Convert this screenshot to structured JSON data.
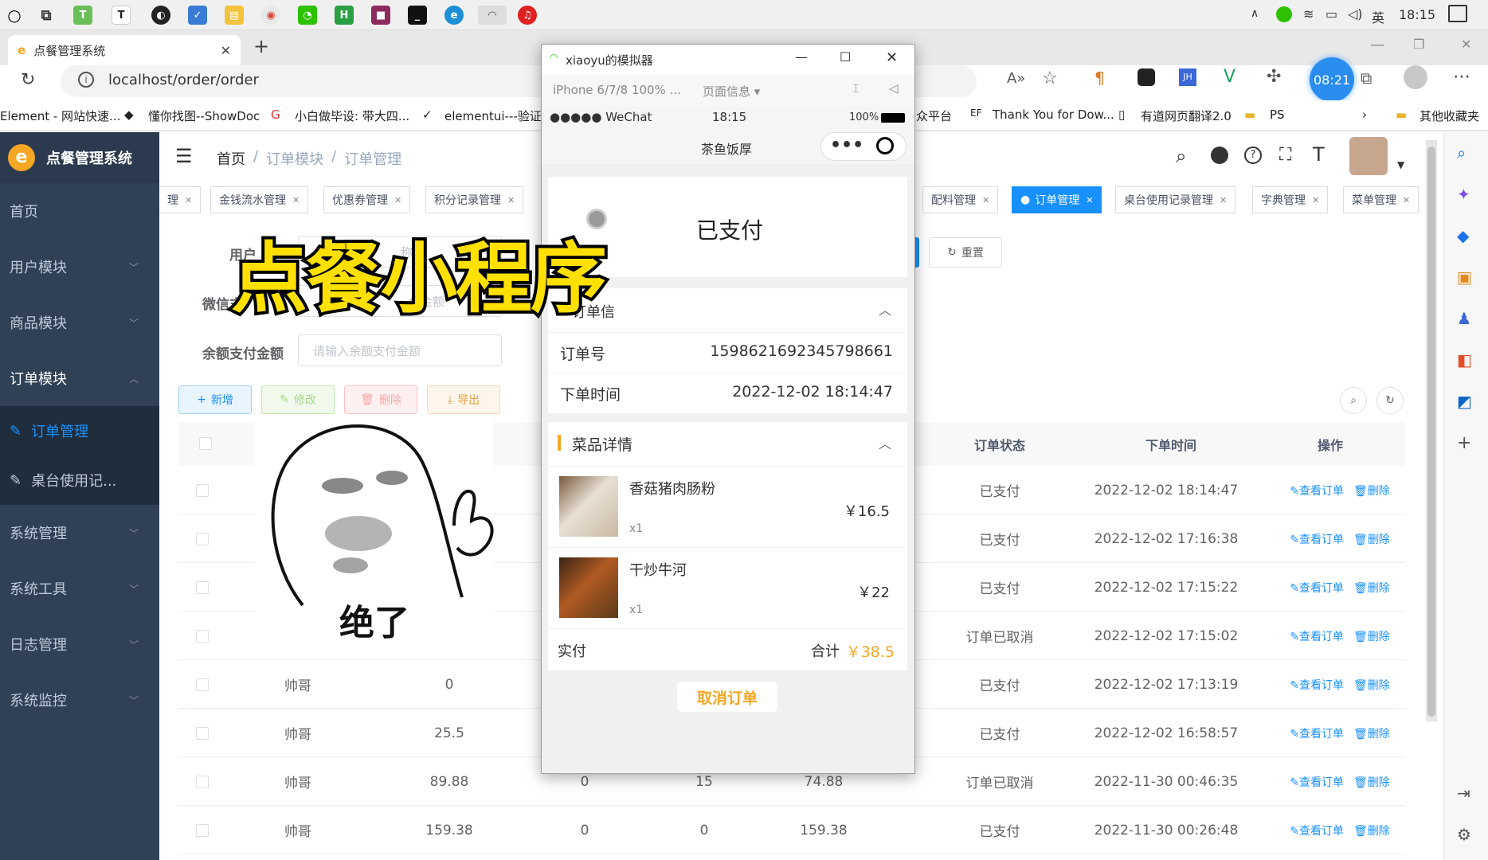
{
  "taskbar": {
    "time": "18:15",
    "ime": "英",
    "app_icons": [
      "cortana-icon",
      "task-view-icon",
      "app-green-icon",
      "typora-icon",
      "app-dark-icon",
      "app-blue-icon",
      "file-explorer-icon",
      "chrome-icon",
      "wechat-icon",
      "hbuilder-icon",
      "jetbrains-icon",
      "terminal-icon",
      "edge-icon",
      "wechat-devtools-icon",
      "netease-music-icon"
    ]
  },
  "browser": {
    "tab_title": "点餐管理系统",
    "url": "localhost/order/order",
    "clock_badge": "08:21",
    "bookmarks": [
      "Element - 网站快速...",
      "懂你找图--ShowDoc",
      "小白做毕设: 带大四...",
      "elementui---验证",
      "众平台",
      "Thank You for Dow...",
      "有道网页翻译2.0",
      "PS",
      "其他收藏夹"
    ]
  },
  "app": {
    "logo_text": "点餐管理系统",
    "menu": [
      {
        "label": "首页",
        "chevron": ""
      },
      {
        "label": "用户模块",
        "chevron": "﹀"
      },
      {
        "label": "商品模块",
        "chevron": "﹀"
      },
      {
        "label": "订单模块",
        "chevron": "︿"
      },
      {
        "label": "订单管理",
        "chevron": ""
      },
      {
        "label": "桌台使用记...",
        "chevron": ""
      },
      {
        "label": "系统管理",
        "chevron": "﹀"
      },
      {
        "label": "系统工具",
        "chevron": "﹀"
      },
      {
        "label": "日志管理",
        "chevron": "﹀"
      },
      {
        "label": "系统监控",
        "chevron": "﹀"
      }
    ],
    "breadcrumb": [
      "首页",
      "订单模块",
      "订单管理"
    ],
    "tags": [
      {
        "label": "理"
      },
      {
        "label": "金钱流水管理"
      },
      {
        "label": "优惠券管理"
      },
      {
        "label": "积分记录管理"
      },
      {
        "label": "配料管理"
      },
      {
        "label": "订单管理",
        "active": true
      },
      {
        "label": "桌台使用记录管理"
      },
      {
        "label": "字典管理"
      },
      {
        "label": "菜单管理"
      }
    ],
    "search": {
      "user_label": "用户",
      "user_placeholder": "称",
      "wechat_label": "微信支",
      "wechat_placeholder": "付金额",
      "balance_label": "余额支付金额",
      "balance_placeholder": "请输入余额支付金额",
      "reset_label": "重置"
    },
    "ops": {
      "add": "新增",
      "edit": "修改",
      "delete": "删除",
      "export": "导出"
    },
    "table": {
      "headers": [
        "订单状态",
        "下单时间",
        "操作"
      ],
      "action_view": "查看订单",
      "action_delete": "删除",
      "rows": [
        {
          "user": "",
          "c1": "",
          "c2": "",
          "c3": "",
          "c4": "",
          "status": "已支付",
          "time": "2022-12-02 18:14:47"
        },
        {
          "user": "",
          "c1": "",
          "c2": "",
          "c3": "",
          "c4": "",
          "status": "已支付",
          "time": "2022-12-02 17:16:38"
        },
        {
          "user": "",
          "c1": "",
          "c2": "",
          "c3": "",
          "c4": "",
          "status": "已支付",
          "time": "2022-12-02 17:15:22"
        },
        {
          "user": "",
          "c1": "",
          "c2": "",
          "c3": "",
          "c4": "",
          "status": "订单已取消",
          "time": "2022-12-02 17:15:02"
        },
        {
          "user": "帅哥",
          "c1": "0",
          "c2": "",
          "c3": "",
          "c4": "",
          "status": "已支付",
          "time": "2022-12-02 17:13:19"
        },
        {
          "user": "帅哥",
          "c1": "25.5",
          "c2": "",
          "c3": "",
          "c4": "",
          "status": "已支付",
          "time": "2022-12-02 16:58:57"
        },
        {
          "user": "帅哥",
          "c1": "89.88",
          "c2": "0",
          "c3": "15",
          "c4": "74.88",
          "status": "订单已取消",
          "time": "2022-11-30 00:46:35"
        },
        {
          "user": "帅哥",
          "c1": "159.38",
          "c2": "0",
          "c3": "0",
          "c4": "159.38",
          "status": "已支付",
          "time": "2022-11-30 00:26:48"
        }
      ]
    }
  },
  "simulator": {
    "window_title": "xiaoyu的模拟器",
    "device": "iPhone 6/7/8 100% ...",
    "page_info": "页面信息 ▾",
    "carrier": "●●●●● WeChat",
    "time": "18:15",
    "battery": "100%",
    "nav_title": "茶鱼饭厚",
    "status_text": "已支付",
    "section_order_info": "订单信",
    "order_no_label": "订单号",
    "order_no": "1598621692345798661",
    "order_time_label": "下单时间",
    "order_time": "2022-12-02 18:14:47",
    "section_dishes": "菜品详情",
    "items": [
      {
        "name": "香菇猪肉肠粉",
        "qty": "x1",
        "price": "￥16.5"
      },
      {
        "name": "干炒牛河",
        "qty": "x1",
        "price": "￥22"
      }
    ],
    "paid_label": "实付",
    "total_label": "合计",
    "total": "￥38.5",
    "cancel_button": "取消订单"
  },
  "overlay": {
    "title": "点餐小程序",
    "meme_caption": "绝了"
  },
  "colors": {
    "sidebar": "#304156",
    "primary": "#1890ff",
    "accent": "#f5a623",
    "overlay_yellow": "#ffe000"
  }
}
